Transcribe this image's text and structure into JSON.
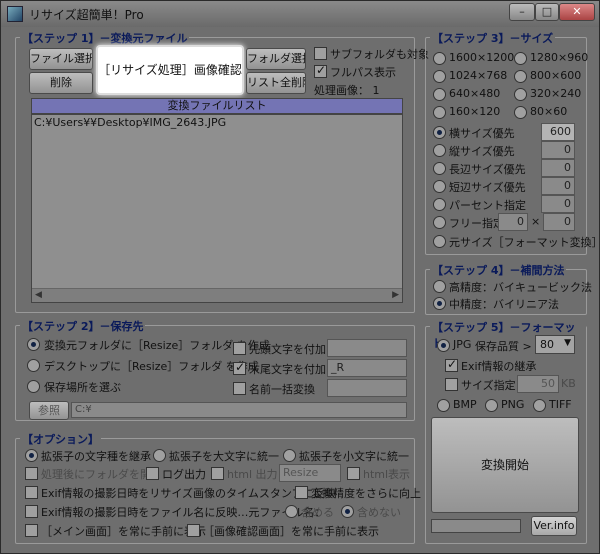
{
  "window": {
    "title": "リサイズ超簡単！Pro",
    "min": "–",
    "max": "□",
    "close": "✕"
  },
  "step1": {
    "title": "【ステップ 1】－変換元ファイル",
    "btn_file_select": "ファイル選択",
    "btn_resize_confirm": "［リサイズ処理］画像確認",
    "btn_folder_select": "フォルダ選択",
    "btn_delete": "削除",
    "btn_delete_all": "リスト全削除",
    "chk_subfolder": "サブフォルダも対象",
    "chk_fullpath": "フルパス表示",
    "processed": "処理画像： 1",
    "list_header": "変換ファイルリスト",
    "files": [
      "C:¥Users¥¥Desktop¥IMG_2643.JPG"
    ]
  },
  "step2": {
    "title": "【ステップ 2】－保存先",
    "opt_same": "変換元フォルダに［Resize］フォルダ を作成",
    "opt_desktop": "デスクトップに［Resize］フォルダ を作成",
    "opt_choose": "保存場所を選ぶ",
    "btn_browse": "参照",
    "path_value": "C:¥",
    "chk_prefix": "先頭文字を付加",
    "chk_suffix": "末尾文字を付加",
    "chk_rename": "名前一括変換",
    "suffix_value": "_R"
  },
  "step3": {
    "title": "【ステップ 3】－サイズ",
    "sizes": [
      "1600×1200",
      "1280×960",
      "1024×768",
      "800×600",
      "640×480",
      "320×240",
      "160×120",
      "80×60"
    ],
    "opt_width": "横サイズ優先",
    "width_value": "600",
    "opt_height": "縦サイズ優先",
    "height_value": "0",
    "opt_long": "長辺サイズ優先",
    "long_value": "0",
    "opt_short": "短辺サイズ優先",
    "short_value": "0",
    "opt_percent": "パーセント指定",
    "percent_value": "0",
    "opt_free": "フリー指定",
    "free_w": "0",
    "free_x": "×",
    "free_h": "0",
    "opt_original": "元サイズ［フォーマット変換］"
  },
  "step4": {
    "title": "【ステップ 4】－補間方法",
    "opt_high": "高精度：バイキュービック法",
    "opt_mid": "中精度：バイリニア法"
  },
  "step5": {
    "title": "【ステップ 5】－フォーマット",
    "opt_jpg": "JPG",
    "quality_label": "保存品質 >",
    "quality_value": "80",
    "chk_exif": "Exif情報の継承",
    "chk_size": "サイズ指定",
    "size_value": "50",
    "size_unit": "KB",
    "opt_bmp": "BMP",
    "opt_png": "PNG",
    "opt_tiff": "TIFF",
    "btn_start": "変換開始",
    "btn_ver": "Ver.info"
  },
  "options": {
    "title": "【オプション】",
    "opt_keep_ext": "拡張子の文字種を継承",
    "opt_upper": "拡張子を大文字に統一",
    "opt_lower": "拡張子を小文字に統一",
    "chk_open_folder": "処理後にフォルダを開く",
    "chk_log": "ログ出力",
    "chk_html": "html 出力",
    "html_value": "Resize",
    "chk_html_show": "html表示",
    "chk_exif_timestamp": "Exif情報の撮影日時をリサイズ画像のタイムスタンプに反映",
    "chk_precision": "変換精度をさらに向上",
    "chk_exif_filename": "Exif情報の撮影日時をファイル名に反映…元ファイル名：",
    "opt_include": "含める",
    "opt_exclude": "含めない",
    "chk_main_top": "［メイン画面］を常に手前に表示",
    "chk_confirm_top": "［画像確認画面］を常に手前に表示"
  }
}
